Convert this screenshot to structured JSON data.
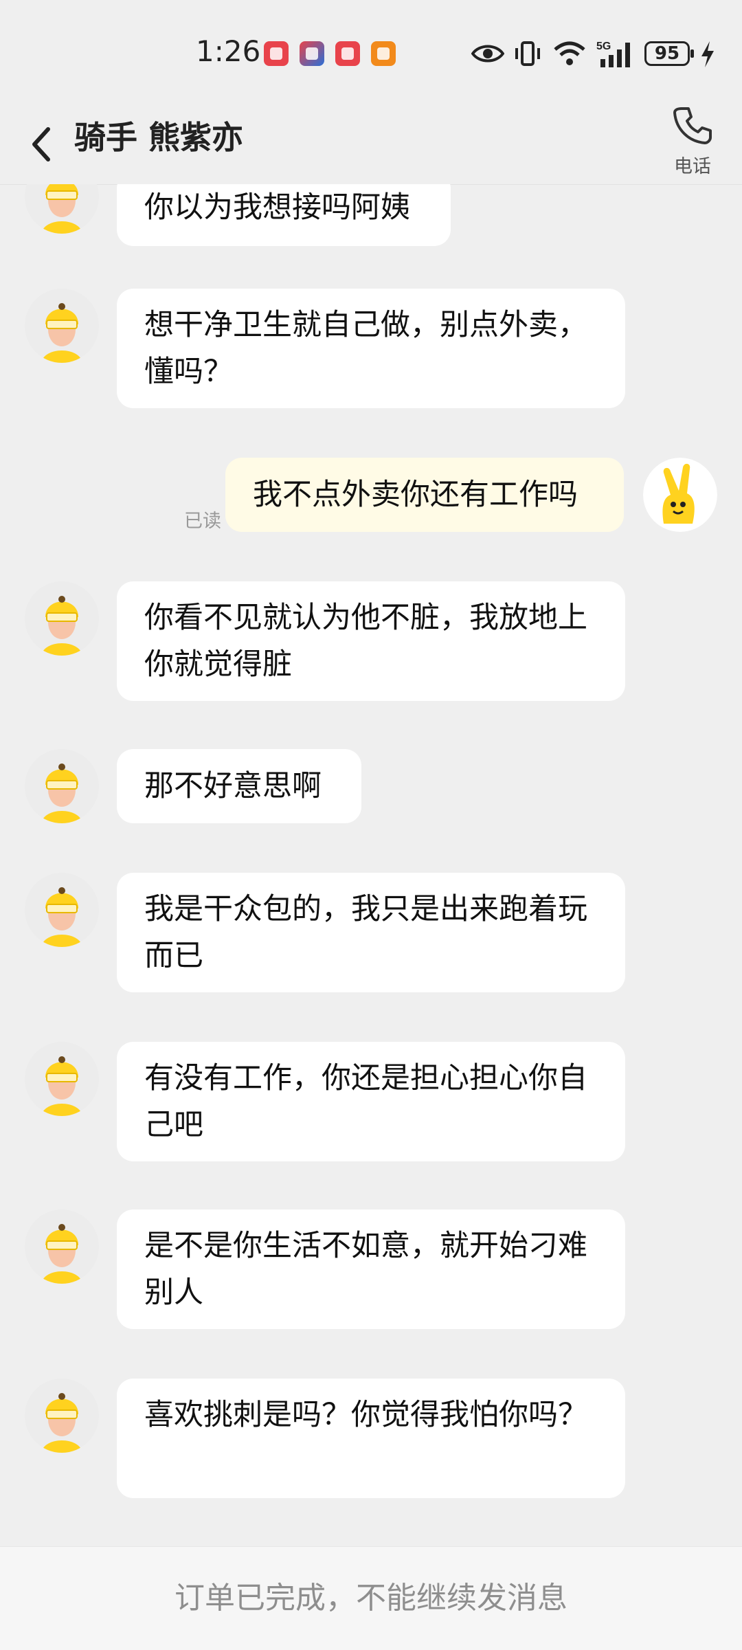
{
  "status_bar": {
    "time": "1:26",
    "battery": "95",
    "icons": [
      "eye-icon",
      "vibrate-icon",
      "wifi-icon",
      "5g-signal-icon",
      "charging-icon"
    ]
  },
  "header": {
    "title": "骑手 熊紫亦",
    "call_label": "电话"
  },
  "messages": [
    {
      "sender": "rider",
      "text": "你以为我想接吗阿姨"
    },
    {
      "sender": "rider",
      "text": "想干净卫生就自己做，别点外卖，懂吗？"
    },
    {
      "sender": "me",
      "text": "我不点外卖你还有工作吗",
      "status": "已读"
    },
    {
      "sender": "rider",
      "text": "你看不见就认为他不脏，我放地上你就觉得脏"
    },
    {
      "sender": "rider",
      "text": " 那不好意思啊"
    },
    {
      "sender": "rider",
      "text": "我是干众包的，我只是出来跑着玩而已"
    },
    {
      "sender": "rider",
      "text": "有没有工作，你还是担心担心你自己吧"
    },
    {
      "sender": "rider",
      "text": "是不是你生活不如意，就开始刁难别人"
    },
    {
      "sender": "rider",
      "text": "喜欢挑刺是吗？你觉得我怕你吗？"
    }
  ],
  "footer": {
    "notice": "订单已完成，不能继续发消息"
  },
  "colors": {
    "background": "#efefef",
    "bubble_other": "#ffffff",
    "bubble_me": "#fffbe6",
    "rider_helmet": "#ffd21f",
    "me_avatar": "#ffd21f"
  }
}
